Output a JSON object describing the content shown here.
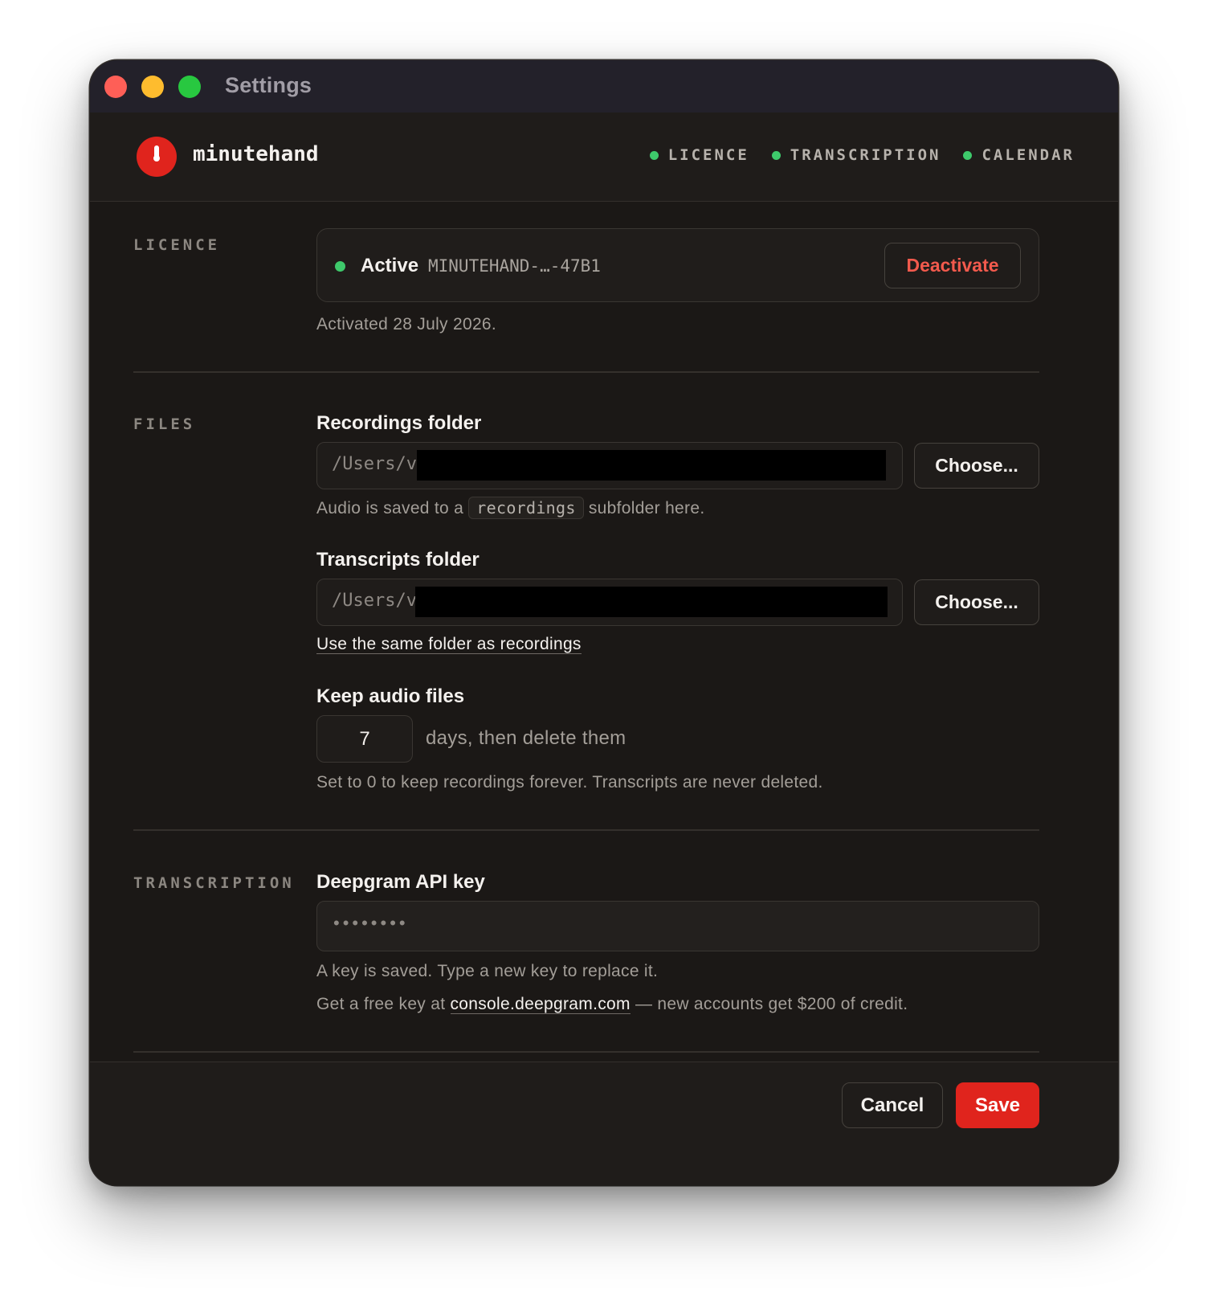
{
  "window": {
    "title": "Settings"
  },
  "header": {
    "brand": "minutehand",
    "logo_icon": "stopwatch-icon",
    "status_items": [
      {
        "label": "LICENCE",
        "status_color": "#3ec96b"
      },
      {
        "label": "TRANSCRIPTION",
        "status_color": "#3ec96b"
      },
      {
        "label": "CALENDAR",
        "status_color": "#3ec96b"
      }
    ]
  },
  "licence": {
    "section_label": "LICENCE",
    "status": "Active",
    "key": "MINUTEHAND-…-47B1",
    "deactivate_label": "Deactivate",
    "activated_text": "Activated 28 July 2026."
  },
  "files": {
    "section_label": "FILES",
    "recordings": {
      "title": "Recordings folder",
      "path_value": "/Users/v",
      "choose_label": "Choose...",
      "help_prefix": "Audio is saved to a",
      "help_code": "recordings",
      "help_suffix": "subfolder here."
    },
    "transcripts": {
      "title": "Transcripts folder",
      "path_value": "/Users/v",
      "choose_label": "Choose...",
      "same_folder_link": "Use the same folder as recordings"
    },
    "keep_audio": {
      "title": "Keep audio files",
      "days_value": "7",
      "days_suffix": "days, then delete them",
      "help": "Set to 0 to keep recordings forever. Transcripts are never deleted."
    }
  },
  "transcription": {
    "section_label": "TRANSCRIPTION",
    "api_key_title": "Deepgram API key",
    "api_key_masked": "••••••••",
    "saved_help": "A key is saved. Type a new key to replace it.",
    "free_key_prefix": "Get a free key at",
    "free_key_link": "console.deepgram.com",
    "free_key_suffix": "— new accounts get $200 of credit."
  },
  "footer": {
    "cancel_label": "Cancel",
    "save_label": "Save"
  },
  "colors": {
    "accent_red": "#e0241d",
    "status_green": "#3ec96b",
    "background": "#1b1816"
  }
}
